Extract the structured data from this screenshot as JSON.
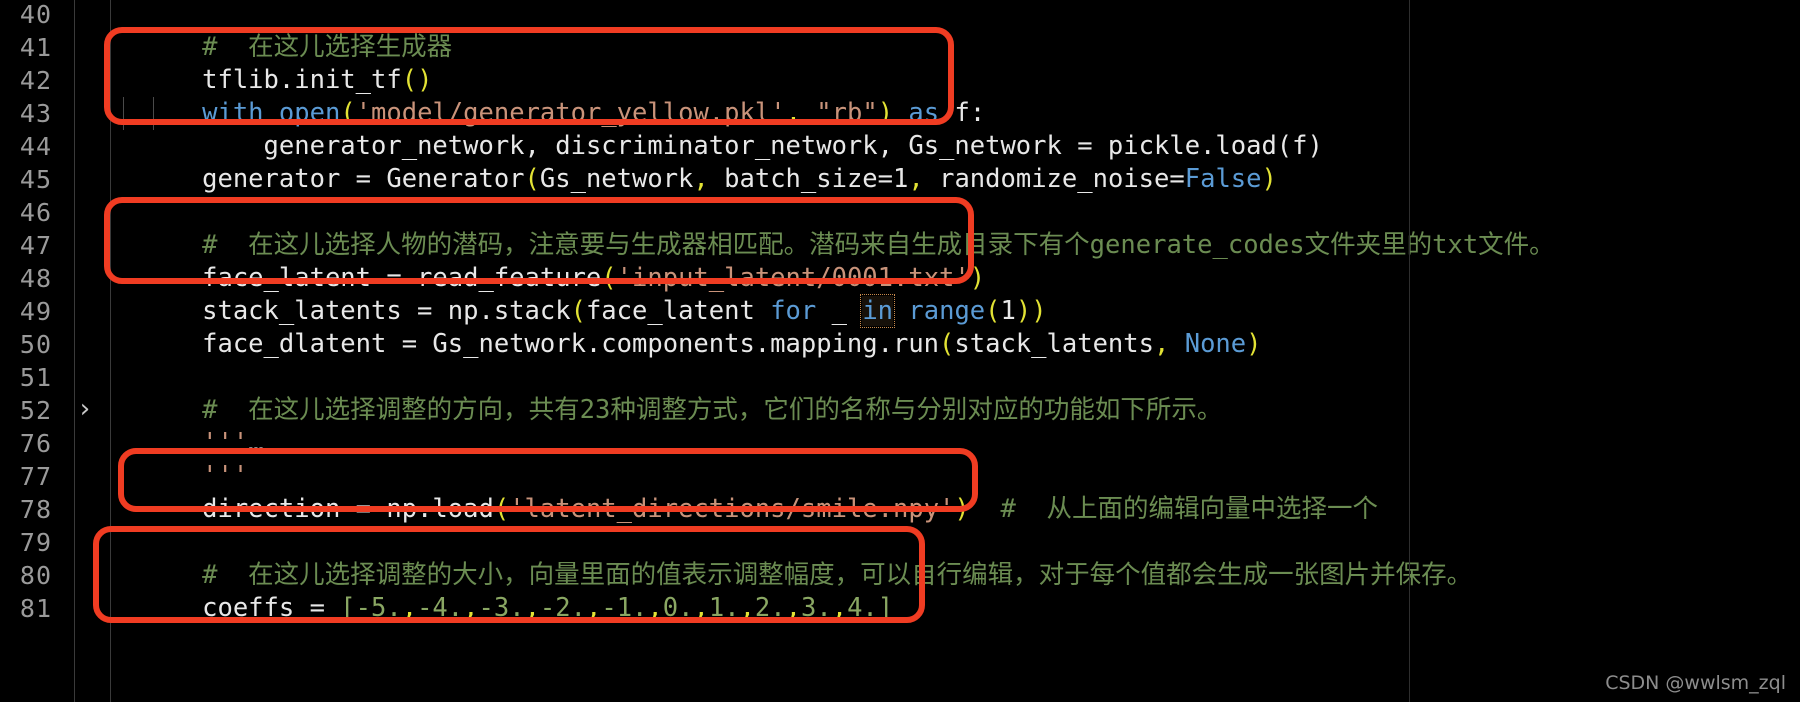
{
  "editor": {
    "theme_background": "#000000",
    "gutter_color": "#9a9a9a",
    "annotation_color": "#f03c22",
    "fold_chevron": "›"
  },
  "line_numbers": [
    "40",
    "41",
    "42",
    "43",
    "44",
    "45",
    "46",
    "47",
    "48",
    "49",
    "50",
    "51",
    "52",
    "76",
    "77",
    "78",
    "79",
    "80",
    "81"
  ],
  "lines": {
    "l40": {
      "comment": "#  在这儿选择生成器"
    },
    "l41": {
      "name": "tflib.init_tf",
      "paren": "()"
    },
    "l42": {
      "kw_with": "with",
      "fn_open": "open",
      "p1": "(",
      "str1": "'model/generator_yellow.pkl'",
      "comma": ",",
      "str2": "\"rb\"",
      "p2": ")",
      "kw_as": "as",
      "var_f": "f:"
    },
    "l43": {
      "vars": "generator_network, discriminator_network, Gs_network",
      "rest": " = pickle.load(f)"
    },
    "l44": {
      "lhs": "generator = Generator",
      "p1": "(",
      "args1": "Gs_network",
      "c1": ",",
      "args2": " batch_size=1",
      "c2": ",",
      "args3": " randomize_noise=",
      "kw_false": "False",
      "p2": ")"
    },
    "l45": {
      "text": ""
    },
    "l46": {
      "comment": "#  在这儿选择人物的潜码，注意要与生成器相匹配。潜码来自生成目录下有个generate_codes文件夹里的txt文件。"
    },
    "l47": {
      "lhs": "face_latent = read_feature",
      "p1": "(",
      "str": "'input_latent/0001.txt'",
      "p2": ")"
    },
    "l48": {
      "lhs": "stack_latents = np.stack",
      "p1": "(",
      "a": "face_latent ",
      "kw_for": "for",
      "us": " _ ",
      "kw_in": "in",
      "fn_range": " range",
      "p2": "(",
      "num": "1",
      "p3": "))"
    },
    "l49": {
      "lhs": "face_dlatent = Gs_network.components.mapping.run",
      "p1": "(",
      "a": "stack_latents",
      "c": ",",
      "kw_none": " None",
      "p2": ")"
    },
    "l50": {
      "text": ""
    },
    "l51": {
      "comment": "#  在这儿选择调整的方向，共有23种调整方式，它们的名称与分别对应的功能如下所示。"
    },
    "l52": {
      "quote": "'''",
      "ellipsis": "…",
      "folded": true
    },
    "l76": {
      "quote": "'''"
    },
    "l77": {
      "lhs": "direction = np.load",
      "p1": "(",
      "str": "'latent_directions/smile.npy'",
      "p2": ")",
      "comment": "#  从上面的编辑向量中选择一个"
    },
    "l78": {
      "text": ""
    },
    "l79": {
      "comment": "#  在这儿选择调整的大小，向量里面的值表示调整幅度，可以自行编辑，对于每个值都会生成一张图片并保存。"
    },
    "l80": {
      "lhs": "coeffs = ",
      "b1": "[",
      "v1": "-5.",
      "c1": ",",
      "v2": "-4.",
      "c2": ",",
      "v3": "-3.",
      "c3": ",",
      "v4": "-2.",
      "c4": ",",
      "v5": "-1.",
      "c5": ",",
      "v6": "0.",
      "c6": ",",
      "v7": "1.",
      "c7": ",",
      "v8": "2.",
      "c8": ",",
      "v9": "3.",
      "c9": ",",
      "v10": "4.",
      "b2": "]"
    },
    "l81": {
      "text": ""
    }
  },
  "annotations": [
    {
      "id": "box-init-tf-with-open",
      "label": "highlight around tflib.init_tf and with open block"
    },
    {
      "id": "box-face-latent",
      "label": "highlight around face_latent read_feature"
    },
    {
      "id": "box-direction",
      "label": "highlight around direction np.load"
    },
    {
      "id": "box-coeffs",
      "label": "highlight around coeffs list"
    }
  ],
  "watermark": {
    "text": "CSDN @wwlsm_zql"
  }
}
